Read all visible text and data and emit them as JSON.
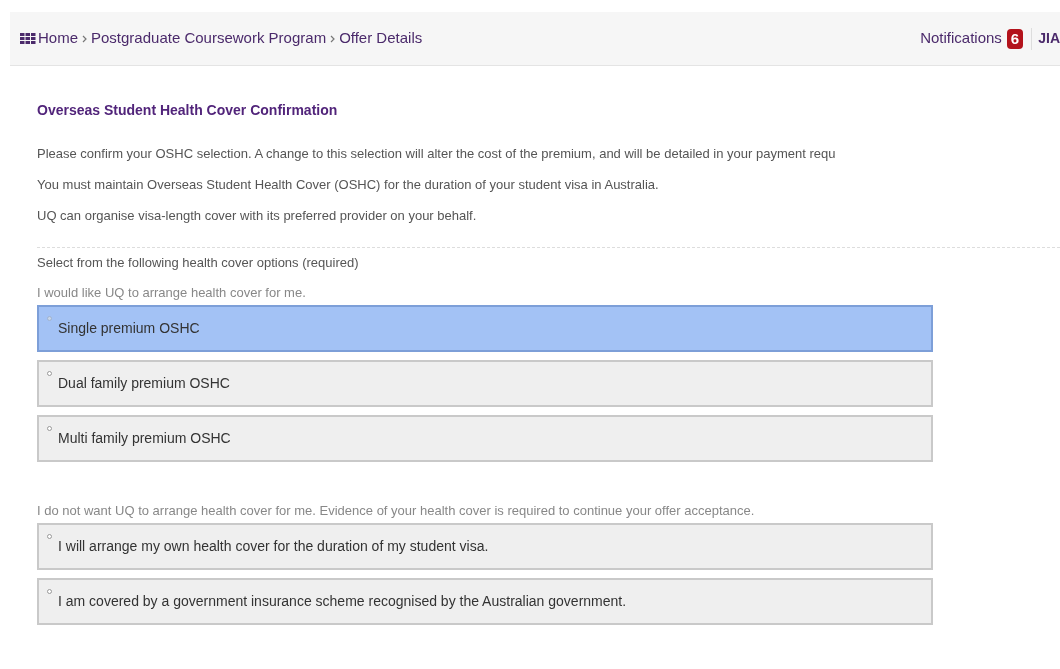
{
  "breadcrumb": [
    {
      "label": "Home"
    },
    {
      "label": "Postgraduate Coursework Program"
    },
    {
      "label": "Offer Details"
    }
  ],
  "notifications": {
    "label": "Notifications",
    "count": "6"
  },
  "user": "JIA",
  "section_title": "Overseas Student Health Cover Confirmation",
  "paragraphs": [
    "Please confirm your OSHC selection. A change to this selection will alter the cost of the premium, and will be detailed in your payment requ",
    "You must maintain Overseas Student Health Cover (OSHC) for the duration of your student visa in Australia.",
    "UQ can organise visa-length cover with its preferred provider on your behalf."
  ],
  "question": "Select from the following health cover options (required)",
  "groups": [
    {
      "caption": "I would like UQ to arrange health cover for me.",
      "options": [
        {
          "label": "Single premium OSHC",
          "selected": true
        },
        {
          "label": "Dual family premium OSHC",
          "selected": false
        },
        {
          "label": "Multi family premium OSHC",
          "selected": false
        }
      ]
    },
    {
      "caption": "I do not want UQ to arrange health cover for me. Evidence of your health cover is required to continue your offer acceptance.",
      "options": [
        {
          "label": "I will arrange my own health cover for the duration of my student visa.",
          "selected": false
        },
        {
          "label": "I am covered by a government insurance scheme recognised by the Australian government.",
          "selected": false
        }
      ]
    }
  ]
}
